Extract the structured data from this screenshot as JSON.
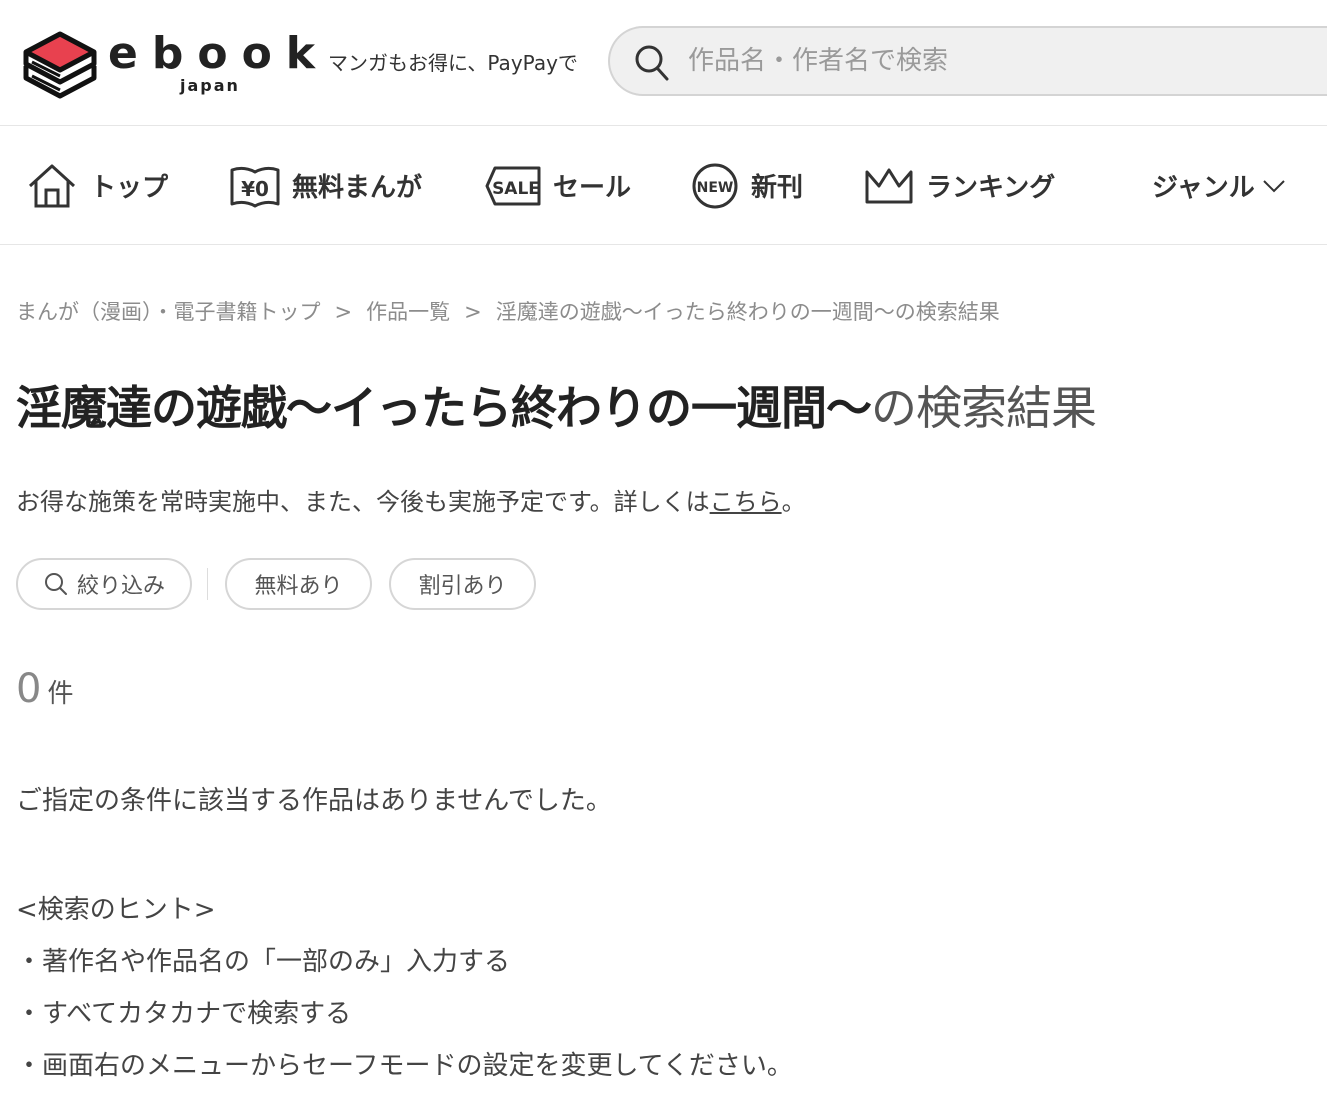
{
  "header": {
    "logo_word": "ebook",
    "logo_sub": "japan",
    "tagline": "マンガもお得に、PayPayで",
    "search_placeholder": "作品名・作者名で検索",
    "search_value": ""
  },
  "nav": {
    "items": [
      {
        "label": "トップ",
        "icon": "home-icon"
      },
      {
        "label": "無料まんが",
        "icon": "free-yen-icon",
        "icon_text": "¥0"
      },
      {
        "label": "セール",
        "icon": "sale-tag-icon",
        "icon_text": "SALE"
      },
      {
        "label": "新刊",
        "icon": "new-badge-icon",
        "icon_text": "NEW"
      },
      {
        "label": "ランキング",
        "icon": "crown-icon"
      },
      {
        "label": "ジャンル",
        "icon": "chevron-down-icon"
      }
    ]
  },
  "breadcrumb": {
    "items": [
      "まんが（漫画）・電子書籍トップ",
      "作品一覧",
      "淫魔達の遊戯～イったら終わりの一週間～の検索結果"
    ],
    "separator": ">"
  },
  "title": {
    "query": "淫魔達の遊戯～イったら終わりの一週間～",
    "suffix": "の検索結果"
  },
  "notice": {
    "text": "お得な施策を常時実施中、また、今後も実施予定です。詳しくは",
    "link": "こちら",
    "end": "。"
  },
  "filters": {
    "refine": "絞り込み",
    "free": "無料あり",
    "discount": "割引あり"
  },
  "results": {
    "count": "0",
    "unit": "件",
    "empty_message": "ご指定の条件に該当する作品はありませんでした。"
  },
  "hints": {
    "heading": "<検索のヒント>",
    "items": [
      "・著作名や作品名の「一部のみ」入力する",
      "・すべてカタカナで検索する",
      "・画面右のメニューからセーフモードの設定を変更してください。"
    ]
  },
  "colors": {
    "brand_red": "#e8414f",
    "text": "#333333",
    "muted": "#8c8c8c",
    "border": "#d6d6d6"
  }
}
